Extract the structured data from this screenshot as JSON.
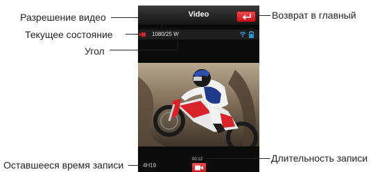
{
  "app": {
    "title": "Video"
  },
  "status": {
    "resolution": "1080/25 W"
  },
  "footer": {
    "duration": "00:12",
    "remaining": "4H19"
  },
  "callouts": {
    "resolution": "Разрешение видео",
    "current_state": "Текущее состояние",
    "angle": "Угол",
    "back_home": "Возврат в главный",
    "rec_duration": "Длительность записи",
    "remaining_time": "Оставшееся время записи"
  },
  "colors": {
    "accent_red": "#d9232a",
    "wifi_blue": "#2aa7e0"
  },
  "icons": {
    "back": "return-arrow-icon",
    "record": "video-camera-icon",
    "wifi": "wifi-icon",
    "battery": "battery-icon"
  }
}
